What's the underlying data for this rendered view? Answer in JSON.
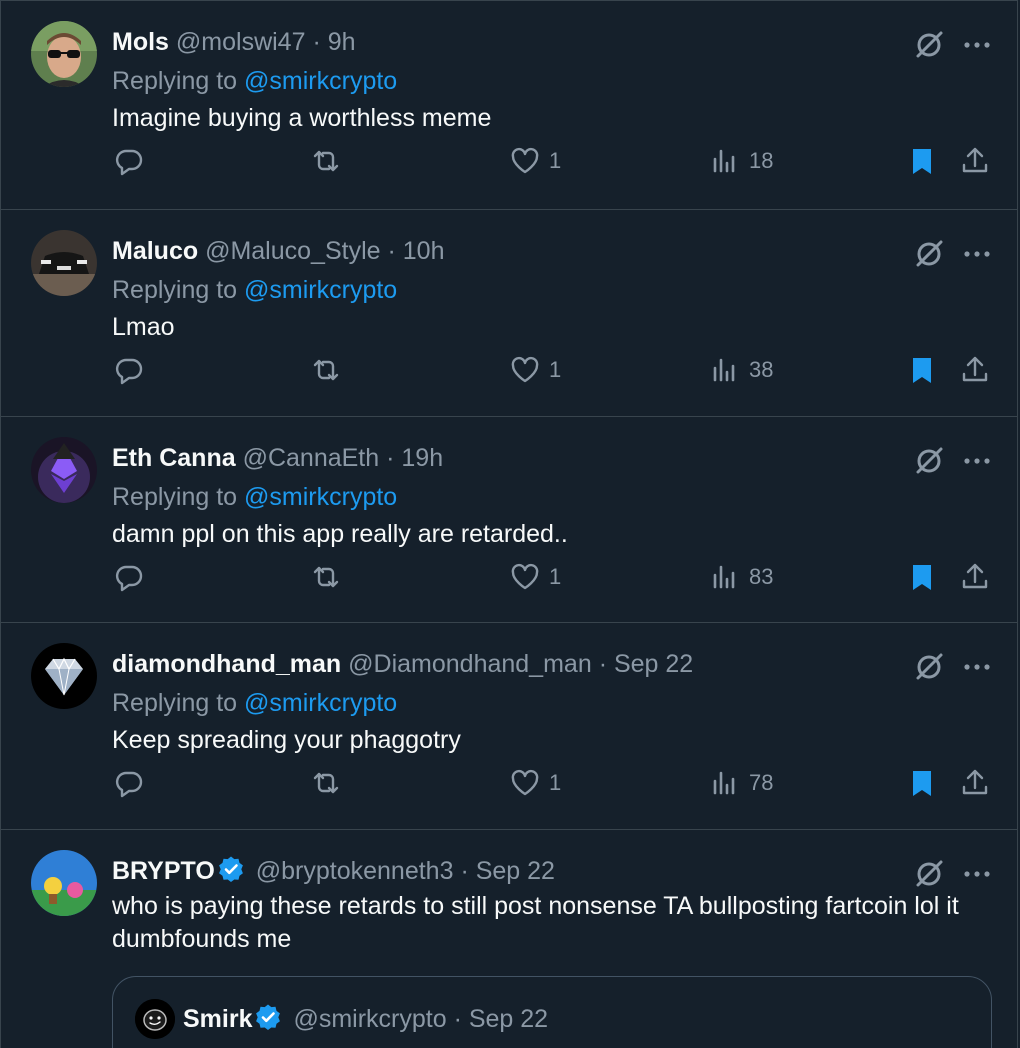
{
  "replies": [
    {
      "name": "Mols",
      "handle": "@molswi47",
      "separator": "·",
      "time": "9h",
      "replying_prefix": "Replying to ",
      "replying_to": "@smirkcrypto",
      "text": "Imagine buying a worthless meme",
      "reply_count": "",
      "retweet_count": "",
      "like_count": "1",
      "view_count": "18",
      "avatar_icon": "avatar-sunglasses-man",
      "bookmarked": true
    },
    {
      "name": "Maluco",
      "handle": "@Maluco_Style",
      "separator": "·",
      "time": "10h",
      "replying_prefix": "Replying to ",
      "replying_to": "@smirkcrypto",
      "text": "Lmao",
      "like_count": "1",
      "view_count": "38",
      "avatar_icon": "avatar-car-rear",
      "bookmarked": true
    },
    {
      "name": "Eth Canna",
      "handle": "@CannaEth",
      "separator": "·",
      "time": "19h",
      "replying_prefix": "Replying to ",
      "replying_to": "@smirkcrypto",
      "text": "damn ppl on this app really are retarded..",
      "like_count": "1",
      "view_count": "83",
      "avatar_icon": "avatar-ethereum-character",
      "bookmarked": true
    },
    {
      "name": "diamondhand_man",
      "handle": "@Diamondhand_man",
      "separator": "·",
      "time": "Sep 22",
      "replying_prefix": "Replying to ",
      "replying_to": "@smirkcrypto",
      "text": "Keep spreading your phaggotry",
      "like_count": "1",
      "view_count": "78",
      "avatar_icon": "avatar-diamond",
      "bookmarked": true
    },
    {
      "name": "BRYPTO",
      "handle": "@bryptokenneth3",
      "separator": "·",
      "time": "Sep 22",
      "text": "who is paying these retards to still post nonsense TA bullposting fartcoin lol it dumbfounds me",
      "avatar_icon": "avatar-cartoon-scene",
      "verified": true
    }
  ],
  "quote": {
    "name": "Smirk",
    "handle": "@smirkcrypto",
    "separator": "·",
    "time": "Sep 22",
    "verified": true,
    "avatar_icon": "avatar-smirk-face"
  },
  "colors": {
    "background": "#15202b",
    "border": "#38444d",
    "text_primary": "#f7f9f9",
    "text_secondary": "#8b98a5",
    "accent": "#1d9bf0"
  }
}
